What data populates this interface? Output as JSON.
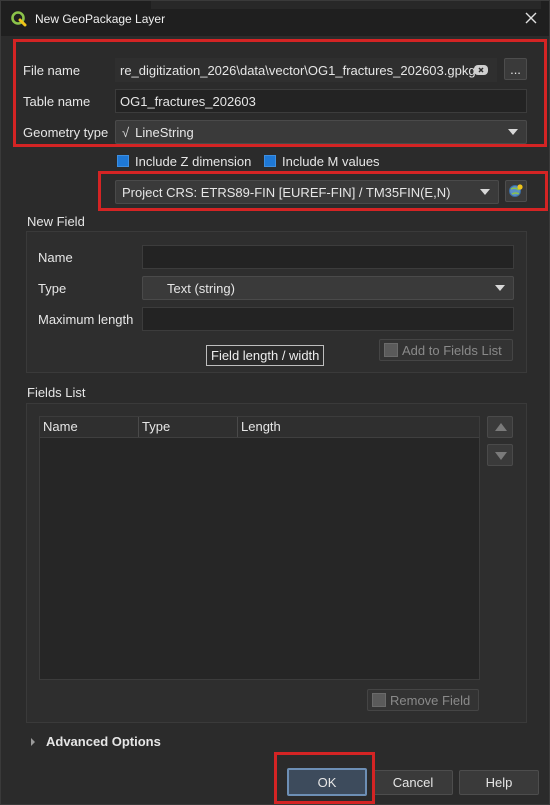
{
  "window": {
    "title": "New GeoPackage Layer"
  },
  "file_name": {
    "label": "File name",
    "value": "re_digitization_2026\\data\\vector\\OG1_fractures_202603.gpkg",
    "browse_label": "..."
  },
  "table_name": {
    "label": "Table name",
    "value": "OG1_fractures_202603"
  },
  "geometry_type": {
    "label": "Geometry type",
    "icon_glyph": "√",
    "value": "LineString"
  },
  "options": {
    "include_z": "Include Z dimension",
    "include_m": "Include M values"
  },
  "crs": {
    "value": "Project CRS: ETRS89-FIN [EUREF-FIN] / TM35FIN(E,N)"
  },
  "new_field": {
    "title": "New Field",
    "name_label": "Name",
    "name_value": "",
    "type_label": "Type",
    "type_value": "Text (string)",
    "max_length_label": "Maximum length",
    "max_length_value": "",
    "add_button": "Add to Fields List",
    "tooltip": "Field length / width"
  },
  "fields_list": {
    "title": "Fields List",
    "columns": [
      "Name",
      "Type",
      "Length"
    ],
    "rows": [],
    "remove_button": "Remove Field"
  },
  "advanced": {
    "label": "Advanced Options"
  },
  "buttons": {
    "ok": "OK",
    "cancel": "Cancel",
    "help": "Help"
  },
  "colors": {
    "highlight_red": "#d42424",
    "checkbox_blue": "#1e78d6",
    "qgis_green": "#5cb85c"
  }
}
